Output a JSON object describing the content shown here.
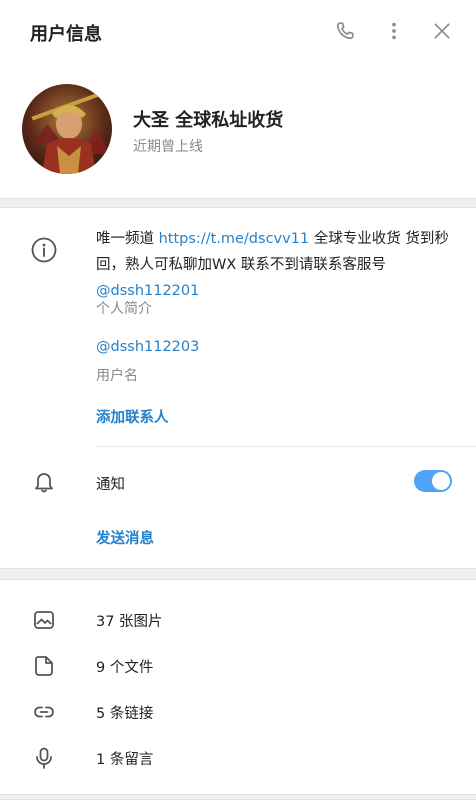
{
  "header": {
    "title": "用户信息"
  },
  "profile": {
    "name": "大圣 全球私址收货",
    "status": "近期曾上线"
  },
  "info": {
    "bio_prefix": "唯一频道 ",
    "bio_link": "https://t.me/dscvv11",
    "bio_rest": " 全球专业收货 货到秒回，熟人可私聊加WX 联系不到请联系客服号 ",
    "bio_mention": "@dssh112201",
    "bio_caption": "个人简介",
    "username": "@dssh112203",
    "username_caption": "用户名",
    "add_contact": "添加联系人"
  },
  "notifications": {
    "label": "通知",
    "enabled": true,
    "send_message": "发送消息"
  },
  "media": [
    {
      "icon": "photo-icon",
      "label": "37 张图片"
    },
    {
      "icon": "file-icon",
      "label": "9 个文件"
    },
    {
      "icon": "link-icon",
      "label": "5 条链接"
    },
    {
      "icon": "microphone-icon",
      "label": "1 条留言"
    }
  ],
  "colors": {
    "accent": "#2481cc",
    "toggle": "#4ea4f6",
    "secondary_text": "#8a8a8a",
    "section_gap": "#f0f0f0"
  }
}
